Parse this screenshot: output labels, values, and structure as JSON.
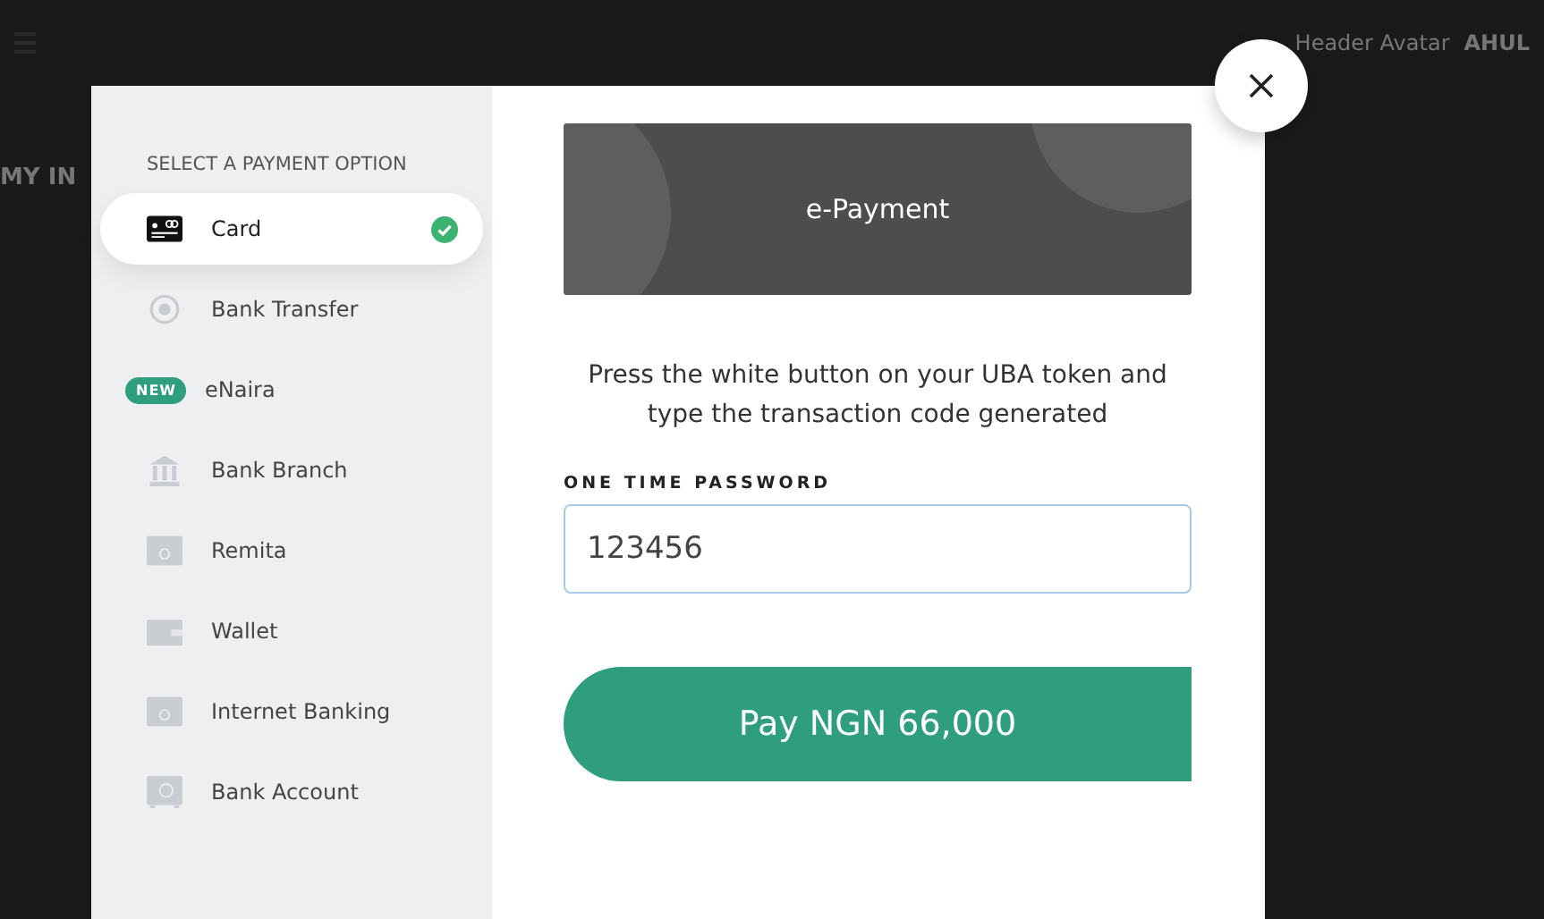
{
  "page": {
    "header_text": "Header Avatar",
    "user_name": "AHUL",
    "section_title": "MY IN"
  },
  "sidebar": {
    "title": "SELECT A PAYMENT OPTION",
    "items": [
      {
        "kind": "card",
        "label": "Card",
        "selected": true
      },
      {
        "kind": "transfer",
        "label": "Bank Transfer",
        "selected": false
      },
      {
        "kind": "new",
        "badge": "NEW",
        "label": "eNaira",
        "selected": false
      },
      {
        "kind": "bank",
        "label": "Bank Branch",
        "selected": false
      },
      {
        "kind": "remita",
        "label": "Remita",
        "selected": false
      },
      {
        "kind": "wallet",
        "label": "Wallet",
        "selected": false
      },
      {
        "kind": "internet",
        "label": "Internet Banking",
        "selected": false
      },
      {
        "kind": "account",
        "label": "Bank Account",
        "selected": false
      }
    ]
  },
  "banner": {
    "title": "e-Payment"
  },
  "instructions": "Press the white button on your UBA token and type the transaction code generated",
  "otp": {
    "label": "ONE TIME PASSWORD",
    "value": "123456"
  },
  "pay_button": "Pay NGN 66,000"
}
